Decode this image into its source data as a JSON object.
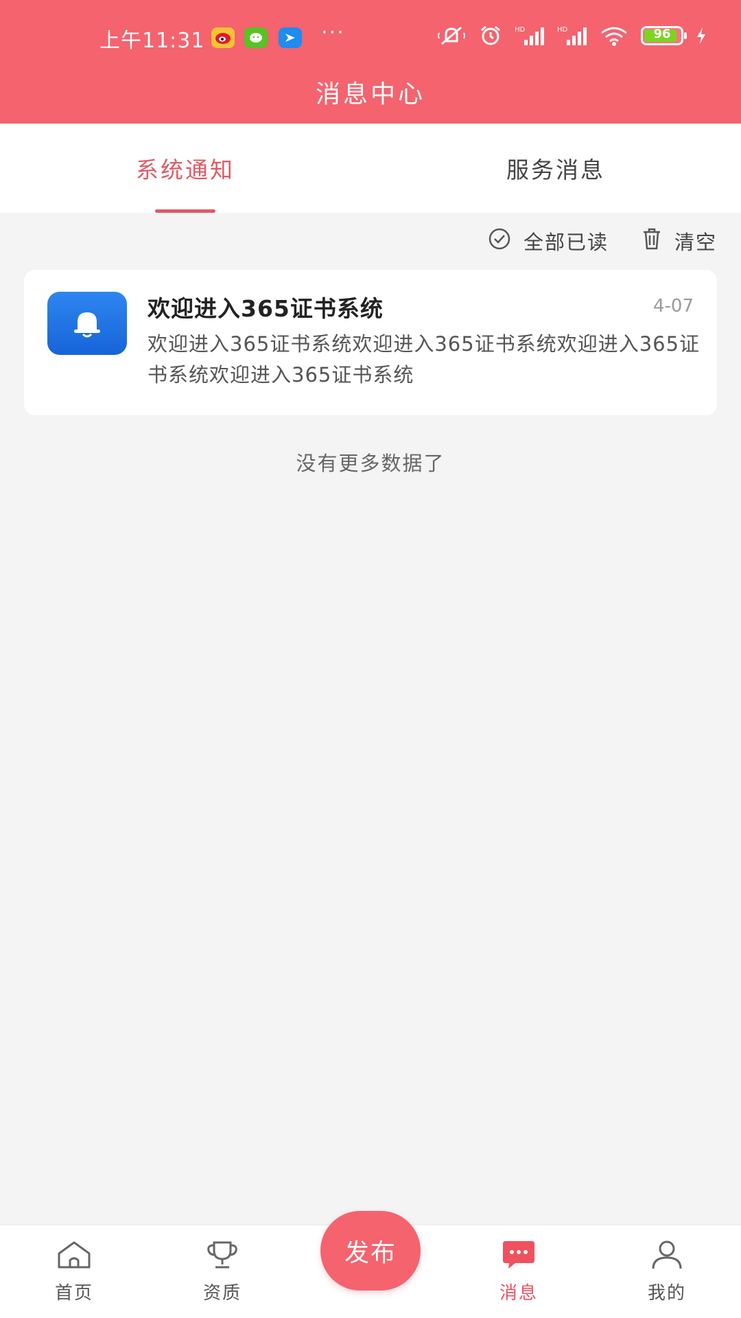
{
  "status_bar": {
    "time": "上午11:31",
    "battery": "96",
    "more": "···"
  },
  "header": {
    "title": "消息中心"
  },
  "tabs": [
    {
      "label": "系统通知",
      "active": true
    },
    {
      "label": "服务消息",
      "active": false
    }
  ],
  "actions": {
    "mark_all_read": "全部已读",
    "clear": "清空"
  },
  "messages": [
    {
      "title": "欢迎进入365证书系统",
      "date": "4-07",
      "body": "欢迎进入365证书系统欢迎进入365证书系统欢迎进入365证书系统欢迎进入365证书系统",
      "icon": "bell-icon"
    }
  ],
  "list_footer": "没有更多数据了",
  "bottom_nav": {
    "items": [
      {
        "label": "首页",
        "icon": "home-icon"
      },
      {
        "label": "资质",
        "icon": "trophy-icon"
      },
      {
        "label": "消息",
        "icon": "message-icon",
        "active": true
      },
      {
        "label": "我的",
        "icon": "user-icon"
      }
    ],
    "publish_label": "发布"
  },
  "colors": {
    "brand": "#f4636e",
    "accent_text": "#e05a64",
    "notification_icon_bg": "#1f74e6"
  }
}
